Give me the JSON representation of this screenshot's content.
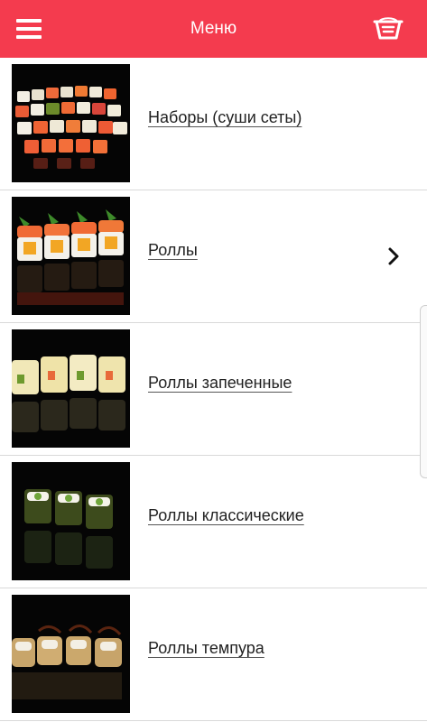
{
  "header": {
    "title": "Меню",
    "menu_icon": "hamburger-menu-icon",
    "cart_icon": "basket-icon",
    "color": "#f43b4e"
  },
  "categories": [
    {
      "label": "Наборы (суши сеты)",
      "image": "sushi-set-photo",
      "chevron": false
    },
    {
      "label": "Роллы",
      "image": "rolls-photo",
      "chevron": true
    },
    {
      "label": "Роллы запеченные",
      "image": "baked-rolls-photo",
      "chevron": false
    },
    {
      "label": "Роллы классические",
      "image": "classic-rolls-photo",
      "chevron": false
    },
    {
      "label": "Роллы темпура",
      "image": "tempura-rolls-photo",
      "chevron": false
    }
  ]
}
